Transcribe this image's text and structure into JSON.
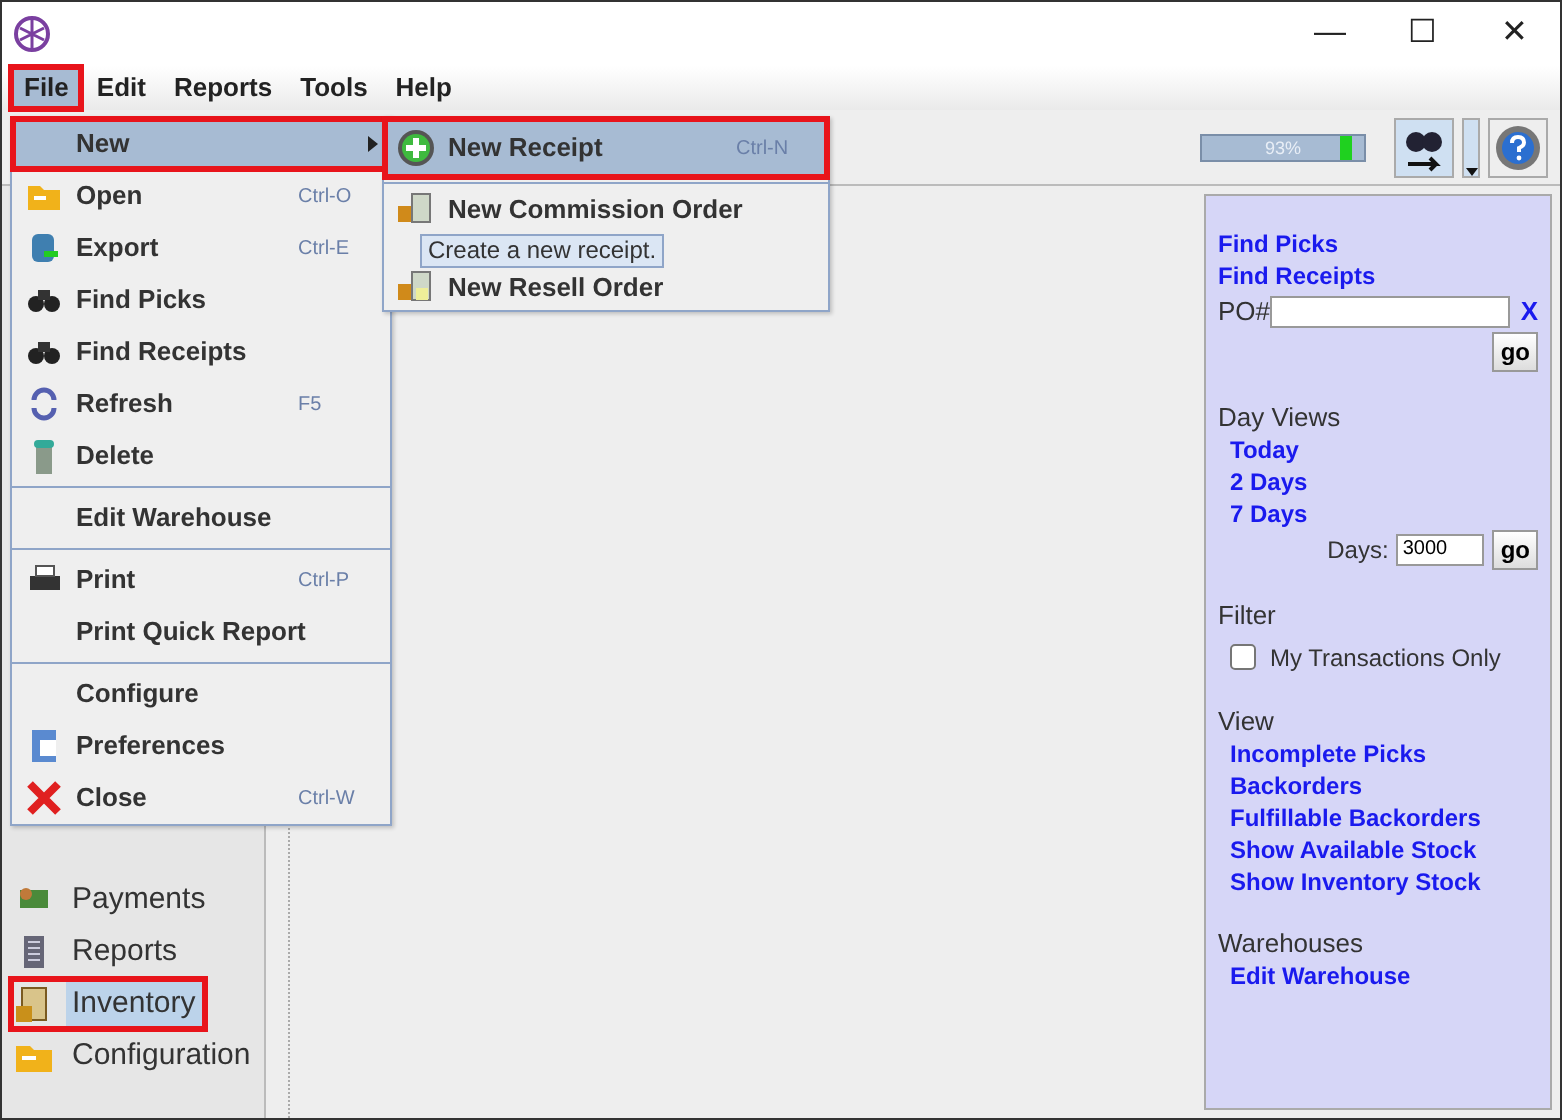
{
  "window": {
    "controls": [
      "—",
      "☐",
      "✕"
    ]
  },
  "menu_bar": [
    {
      "label": "File",
      "selected": true,
      "highlighted": true
    },
    {
      "label": "Edit",
      "selected": false,
      "highlighted": false
    },
    {
      "label": "Reports",
      "selected": false,
      "highlighted": false
    },
    {
      "label": "Tools",
      "selected": false,
      "highlighted": false
    },
    {
      "label": "Help",
      "selected": false,
      "highlighted": false
    }
  ],
  "toolbar": {
    "memory": {
      "level": 0.93,
      "reading": "93%"
    }
  },
  "file_menu": [
    {
      "kind": "item",
      "label": "New",
      "selected": true,
      "highlighted": true,
      "submenu": true
    },
    {
      "kind": "item",
      "label": "Open",
      "shortcut": "Ctrl-O",
      "selected": false,
      "highlighted": false
    },
    {
      "kind": "item",
      "label": "Export",
      "shortcut": "Ctrl-E",
      "selected": false,
      "highlighted": false
    },
    {
      "kind": "item",
      "label": "Find Picks",
      "selected": false,
      "highlighted": false
    },
    {
      "kind": "item",
      "label": "Find Receipts",
      "selected": false,
      "highlighted": false
    },
    {
      "kind": "item",
      "label": "Refresh",
      "shortcut": "F5",
      "selected": false,
      "highlighted": false
    },
    {
      "kind": "item",
      "label": "Delete",
      "selected": false,
      "highlighted": false
    },
    {
      "kind": "separator"
    },
    {
      "kind": "item",
      "label": "Edit Warehouse",
      "selected": false,
      "highlighted": false
    },
    {
      "kind": "separator"
    },
    {
      "kind": "item",
      "label": "Print",
      "shortcut": "Ctrl-P",
      "selected": false,
      "highlighted": false
    },
    {
      "kind": "item",
      "label": "Print Quick Report",
      "selected": false,
      "highlighted": false
    },
    {
      "kind": "separator"
    },
    {
      "kind": "item",
      "label": "Configure",
      "selected": false,
      "highlighted": false
    },
    {
      "kind": "item",
      "label": "Preferences",
      "selected": false,
      "highlighted": false
    },
    {
      "kind": "item",
      "label": "Close",
      "shortcut": "Ctrl-W",
      "selected": false,
      "highlighted": false
    }
  ],
  "new_submenu": [
    {
      "label": "New Receipt",
      "shortcut": "Ctrl-N",
      "selected": true,
      "highlighted": true
    },
    {
      "label": "New Commission Order",
      "selected": false,
      "highlighted": false
    },
    {
      "label": "New Resell Order",
      "selected": false,
      "highlighted": false
    }
  ],
  "tooltip": "Create a new receipt.",
  "sidebar": {
    "items": [
      {
        "label": "Payments",
        "selected": false,
        "highlighted": false
      },
      {
        "label": "Reports",
        "selected": false,
        "highlighted": false
      },
      {
        "label": "Inventory",
        "selected": true,
        "highlighted": true
      },
      {
        "label": "Configuration",
        "selected": false,
        "highlighted": false
      }
    ]
  },
  "right_panel": {
    "find_links": [
      "Find Picks",
      "Find Receipts"
    ],
    "po_label": "PO#",
    "po_clear": "X",
    "po_go": "go",
    "day_views": {
      "heading": "Day Views",
      "links": [
        "Today",
        "2 Days",
        "7 Days"
      ],
      "days_label": "Days:",
      "days_value": "3000",
      "go": "go"
    },
    "filter": {
      "heading": "Filter",
      "checkbox": {
        "label": "My Transactions Only",
        "checked": false
      }
    },
    "view": {
      "heading": "View",
      "links": [
        "Incomplete Picks",
        "Backorders",
        "Fulfillable Backorders",
        "Show Available Stock",
        "Show Inventory Stock"
      ]
    },
    "warehouses": {
      "heading": "Warehouses",
      "links": [
        "Edit Warehouse"
      ]
    }
  }
}
